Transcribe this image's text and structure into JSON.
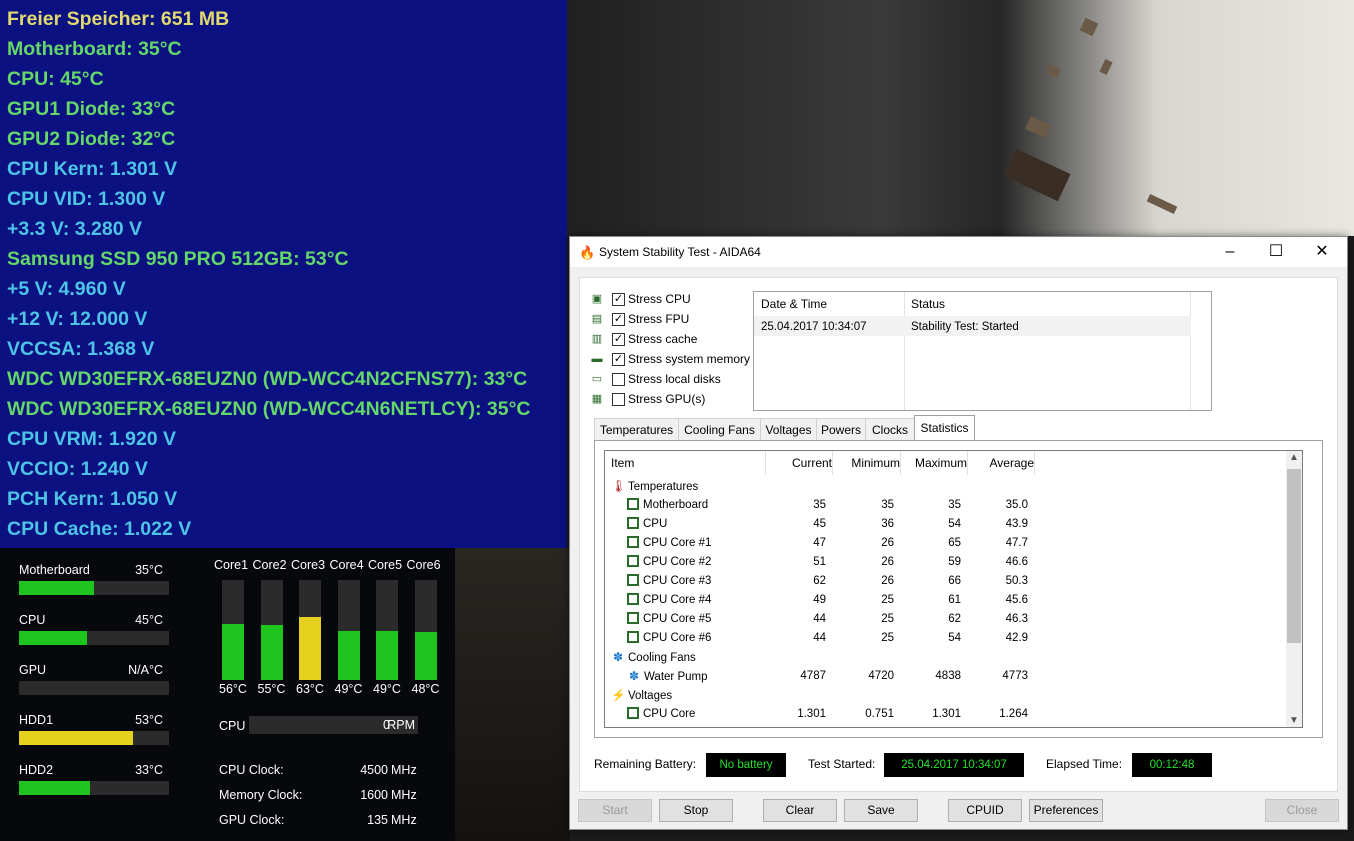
{
  "sensors": [
    {
      "text": "Freier Speicher: 651 MB",
      "color": "yellow"
    },
    {
      "text": "Motherboard: 35°C",
      "color": "green"
    },
    {
      "text": "CPU: 45°C",
      "color": "green"
    },
    {
      "text": "GPU1 Diode: 33°C",
      "color": "green"
    },
    {
      "text": "GPU2 Diode: 32°C",
      "color": "green"
    },
    {
      "text": "CPU Kern: 1.301 V",
      "color": "cyan"
    },
    {
      "text": "CPU VID: 1.300 V",
      "color": "cyan"
    },
    {
      "text": "+3.3 V: 3.280 V",
      "color": "cyan"
    },
    {
      "text": "Samsung SSD 950 PRO 512GB: 53°C",
      "color": "green"
    },
    {
      "text": "+5 V: 4.960 V",
      "color": "cyan"
    },
    {
      "text": "+12 V: 12.000 V",
      "color": "cyan"
    },
    {
      "text": "VCCSA: 1.368 V",
      "color": "cyan"
    },
    {
      "text": "WDC WD30EFRX-68EUZN0 (WD-WCC4N2CFNS77): 33°C",
      "color": "green"
    },
    {
      "text": "WDC WD30EFRX-68EUZN0 (WD-WCC4N6NETLCY): 35°C",
      "color": "green"
    },
    {
      "text": "CPU VRM: 1.920 V",
      "color": "cyan"
    },
    {
      "text": "VCCIO: 1.240 V",
      "color": "cyan"
    },
    {
      "text": "PCH Kern: 1.050 V",
      "color": "cyan"
    },
    {
      "text": "CPU Cache: 1.022 V",
      "color": "cyan"
    }
  ],
  "gadget": {
    "bars": [
      {
        "label": "Motherboard",
        "value": "35°C",
        "fill": 0.5,
        "color": "#1ec51e"
      },
      {
        "label": "CPU",
        "value": "45°C",
        "fill": 0.45,
        "color": "#1ec51e"
      },
      {
        "label": "GPU",
        "value": "N/A°C",
        "fill": 0,
        "color": "#1ec51e"
      },
      {
        "label": "HDD1",
        "value": "53°C",
        "fill": 0.76,
        "color": "#e6d21e"
      },
      {
        "label": "HDD2",
        "value": "33°C",
        "fill": 0.47,
        "color": "#1ec51e"
      }
    ],
    "cores": [
      {
        "label": "Core1",
        "temp": "56°C",
        "fill": 0.56,
        "color": "#1ec51e"
      },
      {
        "label": "Core2",
        "temp": "55°C",
        "fill": 0.55,
        "color": "#1ec51e"
      },
      {
        "label": "Core3",
        "temp": "63°C",
        "fill": 0.63,
        "color": "#e6d21e"
      },
      {
        "label": "Core4",
        "temp": "49°C",
        "fill": 0.49,
        "color": "#1ec51e"
      },
      {
        "label": "Core5",
        "temp": "49°C",
        "fill": 0.49,
        "color": "#1ec51e"
      },
      {
        "label": "Core6",
        "temp": "48°C",
        "fill": 0.48,
        "color": "#1ec51e"
      }
    ],
    "fan_label": "CPU",
    "fan_value": "0",
    "fan_unit": "RPM",
    "clocks": [
      {
        "label": "CPU Clock:",
        "value": "4500",
        "unit": "MHz"
      },
      {
        "label": "Memory Clock:",
        "value": "1600",
        "unit": "MHz"
      },
      {
        "label": "GPU Clock:",
        "value": "135",
        "unit": "MHz"
      }
    ]
  },
  "window": {
    "title": "System Stability Test - AIDA64",
    "minimize": "–",
    "maximize": "☐",
    "close": "✕",
    "stress": [
      {
        "label": "Stress CPU",
        "checked": true,
        "icon": "cpu-icon"
      },
      {
        "label": "Stress FPU",
        "checked": true,
        "icon": "fpu-icon"
      },
      {
        "label": "Stress cache",
        "checked": true,
        "icon": "cache-icon"
      },
      {
        "label": "Stress system memory",
        "checked": true,
        "icon": "memory-icon"
      },
      {
        "label": "Stress local disks",
        "checked": false,
        "icon": "disk-icon"
      },
      {
        "label": "Stress GPU(s)",
        "checked": false,
        "icon": "gpu-icon"
      }
    ],
    "log": {
      "headers": [
        "Date & Time",
        "Status"
      ],
      "rows": [
        [
          "25.04.2017 10:34:07",
          "Stability Test: Started"
        ]
      ]
    },
    "tabs": [
      "Temperatures",
      "Cooling Fans",
      "Voltages",
      "Powers",
      "Clocks",
      "Statistics"
    ],
    "active_tab": "Statistics",
    "stats": {
      "headers": [
        "Item",
        "Current",
        "Minimum",
        "Maximum",
        "Average"
      ],
      "rows": [
        {
          "type": "group",
          "icon": "thermometer-icon",
          "item": "Temperatures"
        },
        {
          "type": "row",
          "icon": "motherboard-icon",
          "item": "Motherboard",
          "current": "35",
          "min": "35",
          "max": "35",
          "avg": "35.0"
        },
        {
          "type": "row",
          "icon": "cpu-icon",
          "item": "CPU",
          "current": "45",
          "min": "36",
          "max": "54",
          "avg": "43.9"
        },
        {
          "type": "row",
          "icon": "cpu-icon",
          "item": "CPU Core #1",
          "current": "47",
          "min": "26",
          "max": "65",
          "avg": "47.7"
        },
        {
          "type": "row",
          "icon": "cpu-icon",
          "item": "CPU Core #2",
          "current": "51",
          "min": "26",
          "max": "59",
          "avg": "46.6"
        },
        {
          "type": "row",
          "icon": "cpu-icon",
          "item": "CPU Core #3",
          "current": "62",
          "min": "26",
          "max": "66",
          "avg": "50.3"
        },
        {
          "type": "row",
          "icon": "cpu-icon",
          "item": "CPU Core #4",
          "current": "49",
          "min": "25",
          "max": "61",
          "avg": "45.6"
        },
        {
          "type": "row",
          "icon": "cpu-icon",
          "item": "CPU Core #5",
          "current": "44",
          "min": "25",
          "max": "62",
          "avg": "46.3"
        },
        {
          "type": "row",
          "icon": "cpu-icon",
          "item": "CPU Core #6",
          "current": "44",
          "min": "25",
          "max": "54",
          "avg": "42.9"
        },
        {
          "type": "group",
          "icon": "fan-icon",
          "item": "Cooling Fans"
        },
        {
          "type": "row",
          "icon": "fan-icon",
          "item": "Water Pump",
          "current": "4787",
          "min": "4720",
          "max": "4838",
          "avg": "4773"
        },
        {
          "type": "group",
          "icon": "voltage-icon",
          "item": "Voltages"
        },
        {
          "type": "row",
          "icon": "cpu-icon",
          "item": "CPU Core",
          "current": "1.301",
          "min": "0.751",
          "max": "1.301",
          "avg": "1.264"
        }
      ]
    },
    "status": {
      "battery_label": "Remaining Battery:",
      "battery_value": "No battery",
      "started_label": "Test Started:",
      "started_value": "25.04.2017 10:34:07",
      "elapsed_label": "Elapsed Time:",
      "elapsed_value": "00:12:48"
    },
    "buttons": {
      "start": "Start",
      "stop": "Stop",
      "clear": "Clear",
      "save": "Save",
      "cpuid": "CPUID",
      "preferences": "Preferences",
      "close": "Close"
    }
  },
  "colors": {
    "yellow": "#e0d870",
    "green": "#64d66a",
    "cyan": "#4ec3e8",
    "status_green": "#22e02a"
  }
}
